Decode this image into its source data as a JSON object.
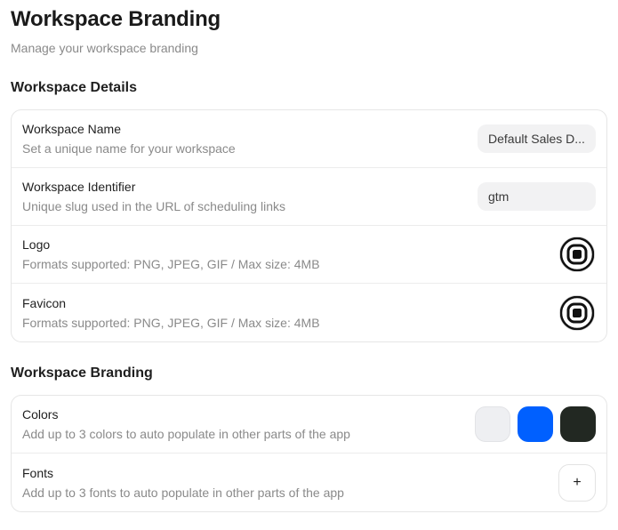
{
  "header": {
    "title": "Workspace Branding",
    "subtitle": "Manage your workspace branding"
  },
  "details": {
    "section_title": "Workspace Details",
    "name": {
      "label": "Workspace Name",
      "description": "Set a unique name for your workspace",
      "value": "Default Sales D..."
    },
    "identifier": {
      "label": "Workspace Identifier",
      "description": "Unique slug used in the URL of scheduling links",
      "value": "gtm"
    },
    "logo": {
      "label": "Logo",
      "description": "Formats supported: PNG, JPEG, GIF / Max size: 4MB",
      "icon": "logo-icon"
    },
    "favicon": {
      "label": "Favicon",
      "description": "Formats supported: PNG, JPEG, GIF / Max size: 4MB",
      "icon": "favicon-icon"
    }
  },
  "branding": {
    "section_title": "Workspace Branding",
    "colors": {
      "label": "Colors",
      "description": "Add up to 3 colors to auto populate in other parts of the app",
      "swatches": [
        "#eeeff2",
        "#0060ff",
        "#222822"
      ]
    },
    "fonts": {
      "label": "Fonts",
      "description": "Add up to 3 fonts to auto populate in other parts of the app",
      "add_label": "+"
    }
  }
}
